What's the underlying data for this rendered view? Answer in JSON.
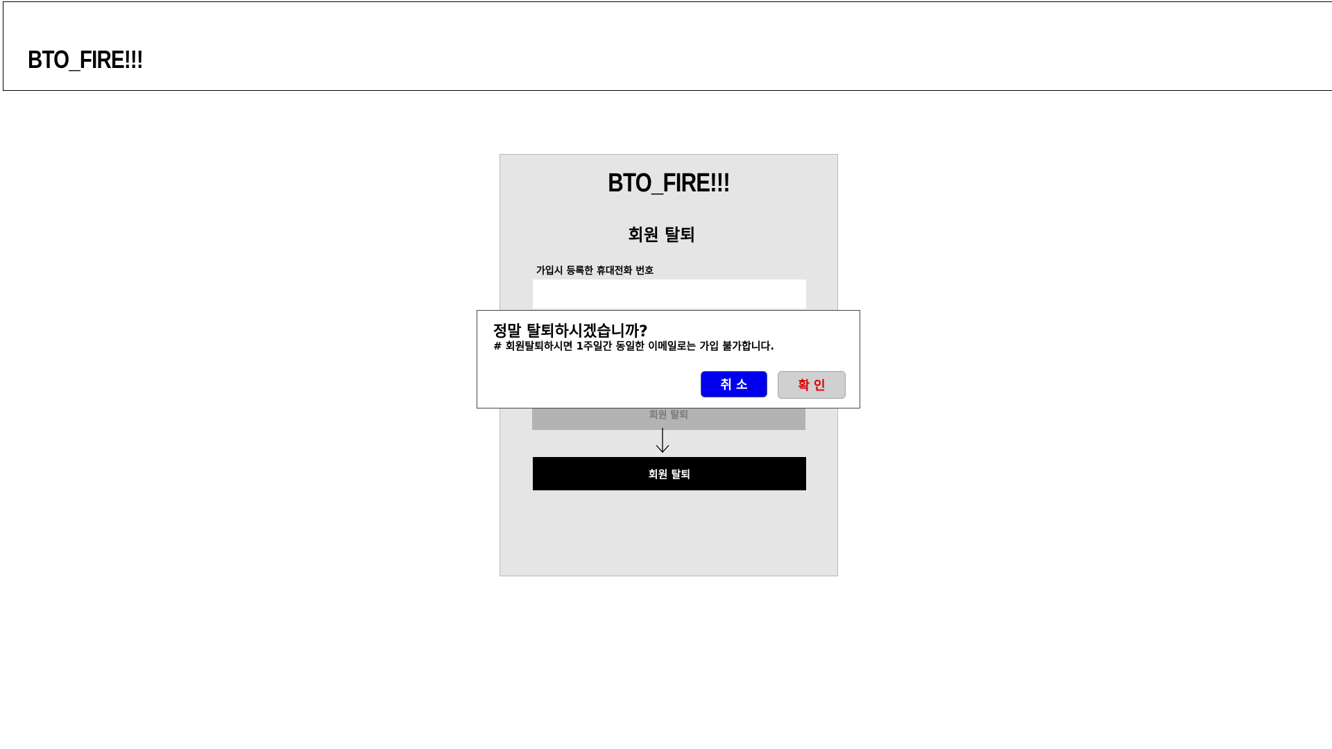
{
  "header": {
    "logo": "BTO_FIRE!!!"
  },
  "card": {
    "logo": "BTO_FIRE!!!",
    "title": "회원 탈퇴",
    "phone_label": "가입시 등록한 휴대전화 번호",
    "phone_value": "",
    "withdraw_disabled_label": "회원 탈퇴",
    "withdraw_label": "회원 탈퇴",
    "flow_arrow_icon": "arrow-down-icon"
  },
  "dialog": {
    "title": "정말 탈퇴하시겠습니까?",
    "message": "# 회원탈퇴하시면 1주일간 동일한 이메일로는 가입 불가합니다.",
    "cancel_label": "취소",
    "confirm_label": "확인"
  },
  "colors": {
    "cancel_button": "#0000ee",
    "confirm_button": "#d0d0d0",
    "confirm_text": "#dd0000",
    "card_background": "#e5e5e5",
    "withdraw_button": "#000000",
    "withdraw_disabled_button": "#b3b3b3"
  }
}
